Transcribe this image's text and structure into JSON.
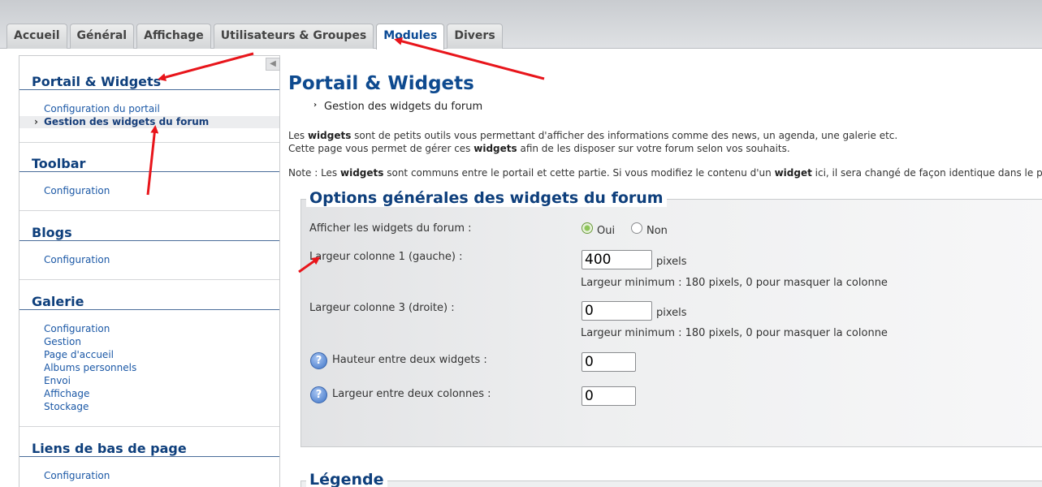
{
  "tabs": [
    {
      "label": "Accueil",
      "active": false
    },
    {
      "label": "Général",
      "active": false
    },
    {
      "label": "Affichage",
      "active": false
    },
    {
      "label": "Utilisateurs & Groupes",
      "active": false
    },
    {
      "label": "Modules",
      "active": true
    },
    {
      "label": "Divers",
      "active": false
    }
  ],
  "sidebar": {
    "collapse_glyph": "◀",
    "sections": [
      {
        "title": "Portail & Widgets",
        "items": [
          {
            "label": "Configuration du portail",
            "active": false
          },
          {
            "label": "Gestion des widgets du forum",
            "active": true
          }
        ]
      },
      {
        "title": "Toolbar",
        "items": [
          {
            "label": "Configuration",
            "active": false
          }
        ]
      },
      {
        "title": "Blogs",
        "items": [
          {
            "label": "Configuration",
            "active": false
          }
        ]
      },
      {
        "title": "Galerie",
        "items": [
          {
            "label": "Configuration",
            "active": false
          },
          {
            "label": "Gestion",
            "active": false
          },
          {
            "label": "Page d'accueil",
            "active": false
          },
          {
            "label": "Albums personnels",
            "active": false
          },
          {
            "label": "Envoi",
            "active": false
          },
          {
            "label": "Affichage",
            "active": false
          },
          {
            "label": "Stockage",
            "active": false
          }
        ]
      },
      {
        "title": "Liens de bas de page",
        "items": [
          {
            "label": "Configuration",
            "active": false
          }
        ]
      }
    ]
  },
  "main": {
    "title": "Portail & Widgets",
    "breadcrumb": "Gestion des widgets du forum",
    "intro": {
      "line1_a": "Les ",
      "line1_b": "widgets",
      "line1_c": " sont de petits outils vous permettant d'afficher des informations comme des news, un agenda, une galerie etc.",
      "line2_a": "Cette page vous permet de gérer ces ",
      "line2_b": "widgets",
      "line2_c": " afin de les disposer sur votre forum selon vos souhaits.",
      "note_a": "Note : Les ",
      "note_b": "widgets",
      "note_c": " sont communs entre le portail et cette partie. Si vous modifiez le contenu d'un ",
      "note_d": "widget",
      "note_e": " ici, il sera changé de façon identique dans le portail et"
    },
    "options": {
      "legend": "Options générales des widgets du forum",
      "show_widgets": {
        "label": "Afficher les widgets du forum :",
        "options": [
          "Oui",
          "Non"
        ],
        "selected": "Oui"
      },
      "col1": {
        "label": "Largeur colonne 1 (gauche) :",
        "value": "400",
        "unit": "pixels",
        "hint": "Largeur minimum : 180 pixels, 0 pour masquer la colonne"
      },
      "col3": {
        "label": "Largeur colonne 3 (droite) :",
        "value": "0",
        "unit": "pixels",
        "hint": "Largeur minimum : 180 pixels, 0 pour masquer la colonne"
      },
      "widget_spacing": {
        "label": "Hauteur entre deux widgets :",
        "value": "0",
        "help_glyph": "?"
      },
      "column_spacing": {
        "label": "Largeur entre deux colonnes :",
        "value": "0",
        "help_glyph": "?"
      }
    },
    "legend_section": {
      "title": "Légende"
    }
  },
  "colors": {
    "annotation_arrow": "#e8151b",
    "title_blue": "#0e4a8f",
    "link_blue": "#1b58a6"
  }
}
